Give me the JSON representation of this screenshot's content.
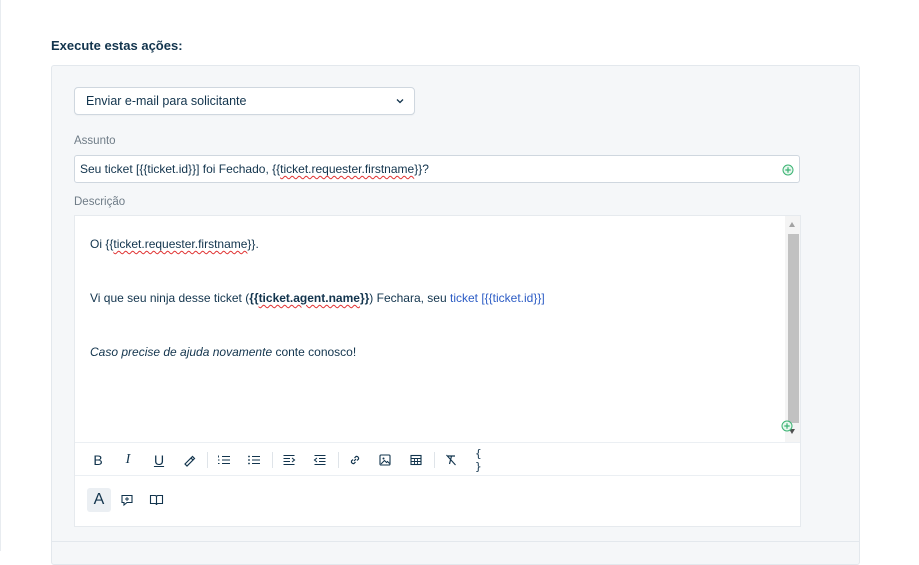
{
  "section_title": "Execute estas ações:",
  "action_select": {
    "value": "Enviar e-mail para solicitante"
  },
  "subject": {
    "label": "Assunto",
    "text_prefix": "Seu ticket [{{ticket.id}}] foi Fechado, {{",
    "text_var": "ticket.requester.firstname",
    "text_suffix": "}}?"
  },
  "description": {
    "label": "Descrição",
    "line1_prefix": "Oi {{",
    "line1_var": "ticket.requester.firstname",
    "line1_suffix": "}}.",
    "line2_prefix": "Vi que seu ninja desse ticket (",
    "line2_bold_open": "{{",
    "line2_bold_var": "ticket.agent.name",
    "line2_bold_close": "}}",
    "line2_mid": ") Fechara, seu ",
    "line2_link": "ticket [{{ticket.id}}]",
    "line3_italic": "Caso precise de ajuda novamente",
    "line3_rest": " conte conosco!"
  },
  "toolbar": {
    "bold": "B",
    "italic": "I",
    "underline": "U",
    "code": "{ }",
    "text_mode": "A"
  },
  "colors": {
    "accent_link": "#2c5cc5",
    "plus_icon": "#3bb373",
    "text": "#12344d"
  },
  "icons": [
    "chevron-down-icon",
    "insert-placeholder-icon",
    "highlight-icon",
    "ordered-list-icon",
    "unordered-list-icon",
    "outdent-icon",
    "indent-icon",
    "link-icon",
    "image-icon",
    "table-icon",
    "clear-format-icon",
    "code-icon",
    "canned-response-icon",
    "solution-article-icon"
  ]
}
